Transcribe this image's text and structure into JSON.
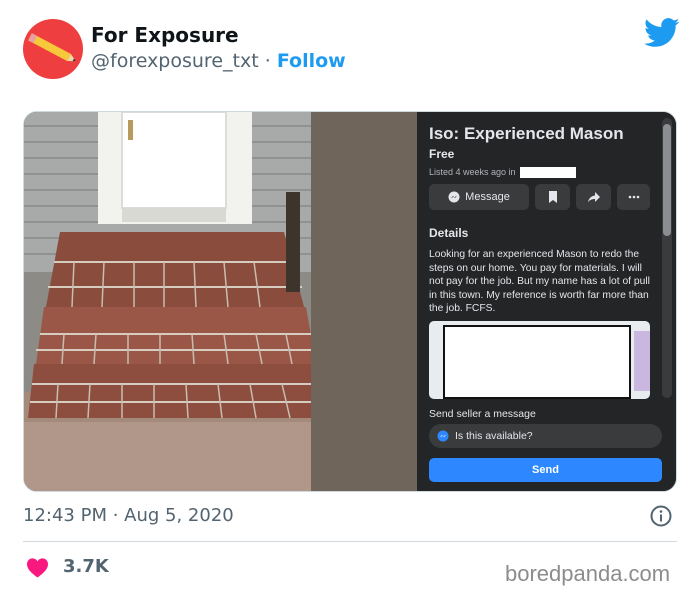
{
  "tweet": {
    "display_name": "For Exposure",
    "handle": "@forexposure_txt",
    "separator": "·",
    "follow_label": "Follow",
    "timestamp": "12:43 PM · Aug 5, 2020",
    "likes": "3.7K",
    "watermark": "boredpanda.com"
  },
  "listing": {
    "title": "Iso: Experienced Mason",
    "price": "Free",
    "listed": "Listed 4 weeks ago in",
    "message_label": "Message",
    "details_heading": "Details",
    "description": "Looking for an experienced Mason to redo the steps on our home. You pay for materials. I will not pay for the job. But my name has a lot of pull in this town. My reference is worth far more than the job. FCFS.",
    "send_seller_label": "Send seller a message",
    "input_value": "Is this available?",
    "send_label": "Send"
  },
  "colors": {
    "twitter_blue": "#1d9bf0",
    "avatar_red": "#ef3e3f",
    "heart_pink": "#f91880",
    "fb_blue": "#2d88ff",
    "fb_panel": "#242526"
  },
  "icons": [
    "twitter-bird-icon",
    "messenger-icon",
    "bookmark-icon",
    "share-icon",
    "more-icon",
    "info-icon",
    "heart-icon"
  ]
}
